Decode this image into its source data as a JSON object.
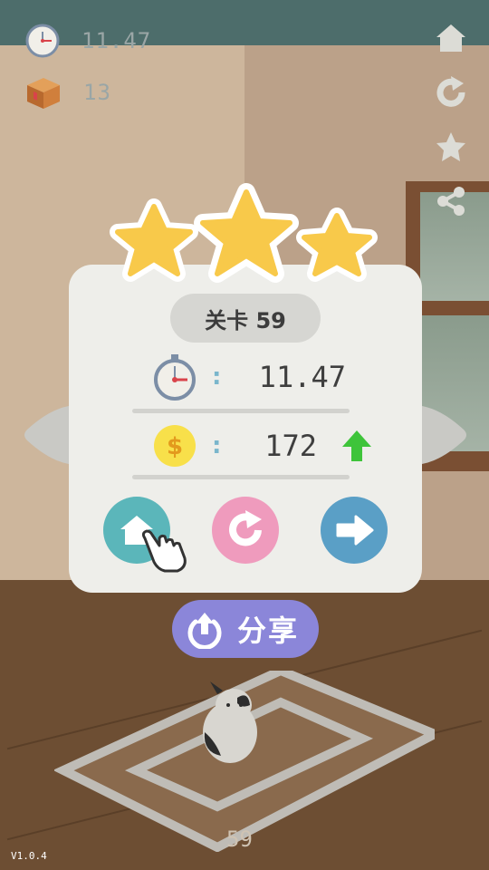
{
  "hud": {
    "time_value": "11.47",
    "box_count": "13"
  },
  "result": {
    "stars_earned": 3,
    "stars_total": 3,
    "level_label": "关卡 59",
    "time": "11.47",
    "coins": "172",
    "colon": ":"
  },
  "share": {
    "label": "分享"
  },
  "scene": {
    "floor_level": "59",
    "version": "V1.0.4"
  },
  "colors": {
    "home_button": "#5bb6ba",
    "retry_button": "#ef9bbd",
    "next_button": "#5a9fc6",
    "share_button": "#8b86d9",
    "star": "#f8c94a",
    "coin": "#f8e04a",
    "up_arrow": "#3ec43a"
  },
  "icons": [
    "clock-icon",
    "box-icon",
    "home-icon",
    "restart-icon",
    "star-icon",
    "share-icon",
    "stopwatch-icon",
    "coin-icon",
    "arrow-up-icon",
    "hand-pointer-icon"
  ]
}
